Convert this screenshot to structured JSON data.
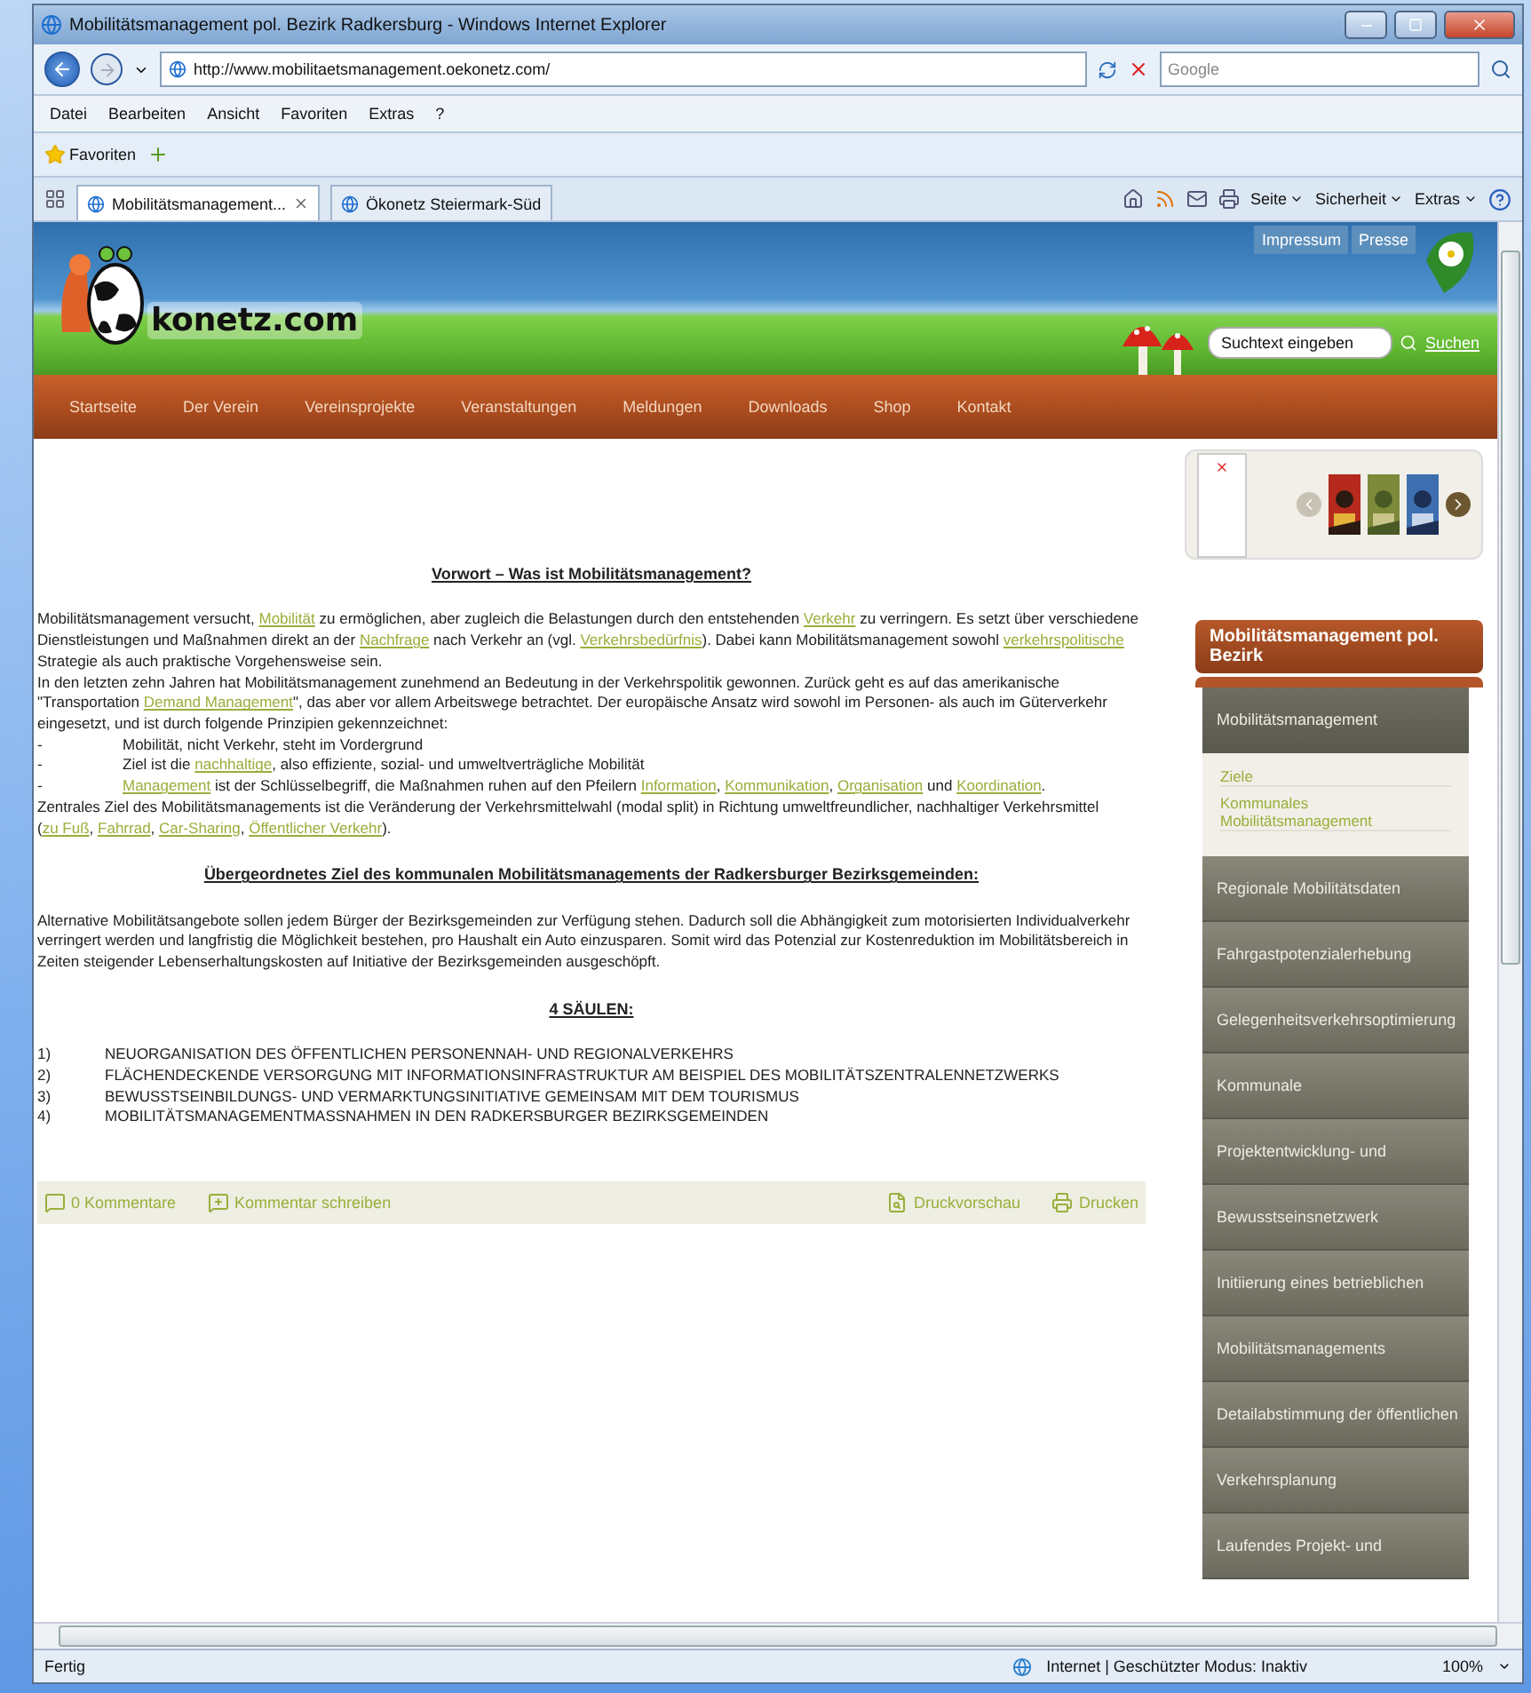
{
  "browser": {
    "title": "Mobilitätsmanagement pol. Bezirk Radkersburg - Windows Internet Explorer",
    "url": "http://www.mobilitaetsmanagement.oekonetz.com/",
    "search_placeholder": "Google",
    "menu": [
      "Datei",
      "Bearbeiten",
      "Ansicht",
      "Favoriten",
      "Extras",
      "?"
    ],
    "favorites": "Favoriten",
    "tabs": [
      {
        "label": "Mobilitätsmanagement...",
        "selected": true
      },
      {
        "label": "Ökonetz Steiermark-Süd",
        "selected": false
      }
    ],
    "commands": [
      "Seite",
      "Sicherheit",
      "Extras"
    ]
  },
  "site": {
    "logo": "konetz.com",
    "header_links": [
      "Impressum",
      "Presse"
    ],
    "search_placeholder": "Suchtext eingeben",
    "search_link": "Suchen",
    "nav": [
      "Startseite",
      "Der Verein",
      "Vereinsprojekte",
      "Veranstaltungen",
      "Meldungen",
      "Downloads",
      "Shop",
      "Kontakt"
    ]
  },
  "article": [
    {
      "kind": "heading",
      "text": "Vorwort – Was ist Mobilitätsmanagement?"
    },
    {
      "kind": "paragraph",
      "parts": [
        {
          "text": "Mobilitätsmanagement versucht, ",
          "kind": "text"
        },
        {
          "text": "Mobilität",
          "kind": "link"
        },
        {
          "text": " zu ermöglichen, aber zugleich die Belastungen durch den entstehenden ",
          "kind": "text"
        },
        {
          "text": "Verkehr",
          "kind": "link"
        },
        {
          "text": " zu verringern. Es setzt über verschiedene Dienstleistungen und Maßnahmen direkt an der ",
          "kind": "text"
        },
        {
          "text": "Nachfrage",
          "kind": "link"
        },
        {
          "text": " nach Verkehr an (vgl. ",
          "kind": "text"
        },
        {
          "text": "Verkehrsbedürfnis",
          "kind": "link"
        },
        {
          "text": "). Dabei kann Mobilitätsmanagement sowohl ",
          "kind": "text"
        },
        {
          "text": "verkehrspolitische",
          "kind": "link"
        },
        {
          "text": " Strategie als auch praktische Vorgehensweise sein.",
          "kind": "text"
        }
      ]
    },
    {
      "kind": "paragraph",
      "parts": [
        {
          "text": "In den letzten zehn Jahren hat Mobilitätsmanagement zunehmend an Bedeutung in der Verkehrspolitik gewonnen. Zurück geht es auf das amerikanische \"Transportation ",
          "kind": "text"
        },
        {
          "text": "Demand Management",
          "kind": "link"
        },
        {
          "text": "\", das aber vor allem Arbeitswege betrachtet. Der europäische Ansatz wird sowohl im Personen- als auch im Güterverkehr eingesetzt, und ist durch folgende Prinzipien gekennzeichnet:",
          "kind": "text"
        }
      ]
    },
    {
      "kind": "bullet",
      "marker": "-",
      "parts": [
        {
          "text": "Mobilität, nicht Verkehr, steht im Vordergrund",
          "kind": "text"
        }
      ]
    },
    {
      "kind": "bullet",
      "marker": "-",
      "parts": [
        {
          "text": "Ziel ist die ",
          "kind": "text"
        },
        {
          "text": "nachhaltige",
          "kind": "link"
        },
        {
          "text": ", also effiziente, sozial- und umweltverträgliche Mobilität",
          "kind": "text"
        }
      ]
    },
    {
      "kind": "bullet",
      "marker": "-",
      "parts": [
        {
          "text": "Management",
          "kind": "link"
        },
        {
          "text": " ist der Schlüsselbegriff, die Maßnahmen ruhen auf den Pfeilern ",
          "kind": "text"
        },
        {
          "text": "Information",
          "kind": "link"
        },
        {
          "text": ", ",
          "kind": "text"
        },
        {
          "text": "Kommunikation",
          "kind": "link"
        },
        {
          "text": ", ",
          "kind": "text"
        },
        {
          "text": "Organisation",
          "kind": "link"
        },
        {
          "text": " und ",
          "kind": "text"
        },
        {
          "text": "Koordination",
          "kind": "link"
        },
        {
          "text": ".",
          "kind": "text"
        }
      ]
    },
    {
      "kind": "paragraph",
      "parts": [
        {
          "text": "Zentrales Ziel des Mobilitätsmanagements ist die Veränderung der Verkehrsmittelwahl (modal split) in Richtung umweltfreundlicher, nachhaltiger Verkehrsmittel (",
          "kind": "text"
        },
        {
          "text": "zu Fuß",
          "kind": "link"
        },
        {
          "text": ", ",
          "kind": "text"
        },
        {
          "text": "Fahrrad",
          "kind": "link"
        },
        {
          "text": ", ",
          "kind": "text"
        },
        {
          "text": "Car-Sharing",
          "kind": "link"
        },
        {
          "text": ", ",
          "kind": "text"
        },
        {
          "text": "Öffentlicher Verkehr",
          "kind": "link"
        },
        {
          "text": ").",
          "kind": "text"
        }
      ]
    },
    {
      "kind": "heading",
      "text": "Übergeordnetes Ziel des kommunalen Mobilitätsmanagements der Radkersburger Bezirksgemeinden:"
    },
    {
      "kind": "paragraph",
      "parts": [
        {
          "text": "Alternative Mobilitätsangebote sollen jedem Bürger der Bezirksgemeinden zur Verfügung stehen. Dadurch soll die Abhängigkeit zum motorisierten Individualverkehr verringert werden und langfristig die Möglichkeit bestehen, pro Haushalt ein Auto einzusparen. Somit wird das Potenzial zur Kostenreduktion im Mobilitätsbereich in Zeiten steigender Lebenserhaltungskosten auf Initiative der Bezirksgemeinden ausgeschöpft.",
          "kind": "text"
        }
      ]
    },
    {
      "kind": "heading",
      "text": "4 SÄULEN:"
    },
    {
      "kind": "numbered",
      "marker": "1)",
      "parts": [
        {
          "text": "NEUORGANISATION DES ÖFFENTLICHEN PERSONENNAH- UND REGIONALVERKEHRS",
          "kind": "text"
        }
      ]
    },
    {
      "kind": "numbered",
      "marker": "2)",
      "parts": [
        {
          "text": "FLÄCHENDECKENDE VERSORGUNG MIT INFORMATIONSINFRASTRUKTUR AM BEISPIEL DES MOBILITÄTSZENTRALENNETZWERKS",
          "kind": "text"
        }
      ]
    },
    {
      "kind": "numbered",
      "marker": "3)",
      "parts": [
        {
          "text": "BEWUSSTSEINBILDUNGS- UND VERMARKTUNGSINITIATIVE GEMEINSAM MIT DEM TOURISMUS",
          "kind": "text"
        }
      ]
    },
    {
      "kind": "numbered",
      "marker": "4)",
      "parts": [
        {
          "text": "MOBILITÄTSMANAGEMENTMASSNAHMEN IN DEN RADKERSBURGER BEZIRKSGEMEINDEN",
          "kind": "text"
        }
      ]
    }
  ],
  "article_actions": [
    {
      "label": "0 Kommentare",
      "kind": "comments"
    },
    {
      "label": "Kommentar schreiben",
      "kind": "write"
    },
    {
      "label": "Druckvorschau",
      "kind": "preview"
    },
    {
      "label": "Drucken",
      "kind": "print"
    }
  ],
  "sidebar": {
    "slider": {
      "previous_disabled": true,
      "next_disabled": false
    },
    "box_title": "Mobilitätsmanagement pol. Bezirk",
    "menu": [
      {
        "label": "Mobilitätsmanagement",
        "expanded": true,
        "children": [
          {
            "label": "Ziele"
          },
          {
            "label": "Kommunales Mobilitätsmanagement"
          }
        ]
      },
      {
        "label": "Regionale Mobilitätsdaten",
        "expanded": false
      },
      {
        "label": "Fahrgastpotenzialerhebung",
        "expanded": false
      },
      {
        "label": "Gelegenheitsverkehrsoptimierung",
        "expanded": false
      },
      {
        "label": "Kommunale",
        "expanded": false
      },
      {
        "label": "Projektentwicklung- und",
        "expanded": false
      },
      {
        "label": "Bewusstseinsnetzwerk",
        "expanded": false
      },
      {
        "label": "Initiierung eines betrieblichen",
        "expanded": false
      },
      {
        "label": "Mobilitätsmanagements",
        "expanded": false
      },
      {
        "label": "Detailabstimmung der öffentlichen",
        "expanded": false
      },
      {
        "label": "Verkehrsplanung",
        "expanded": false
      },
      {
        "label": "Laufendes Projekt- und",
        "expanded": false
      }
    ]
  },
  "status": {
    "text": "Fertig",
    "zone": "Internet | Geschützter Modus: Inaktiv",
    "zoom": "100%"
  }
}
